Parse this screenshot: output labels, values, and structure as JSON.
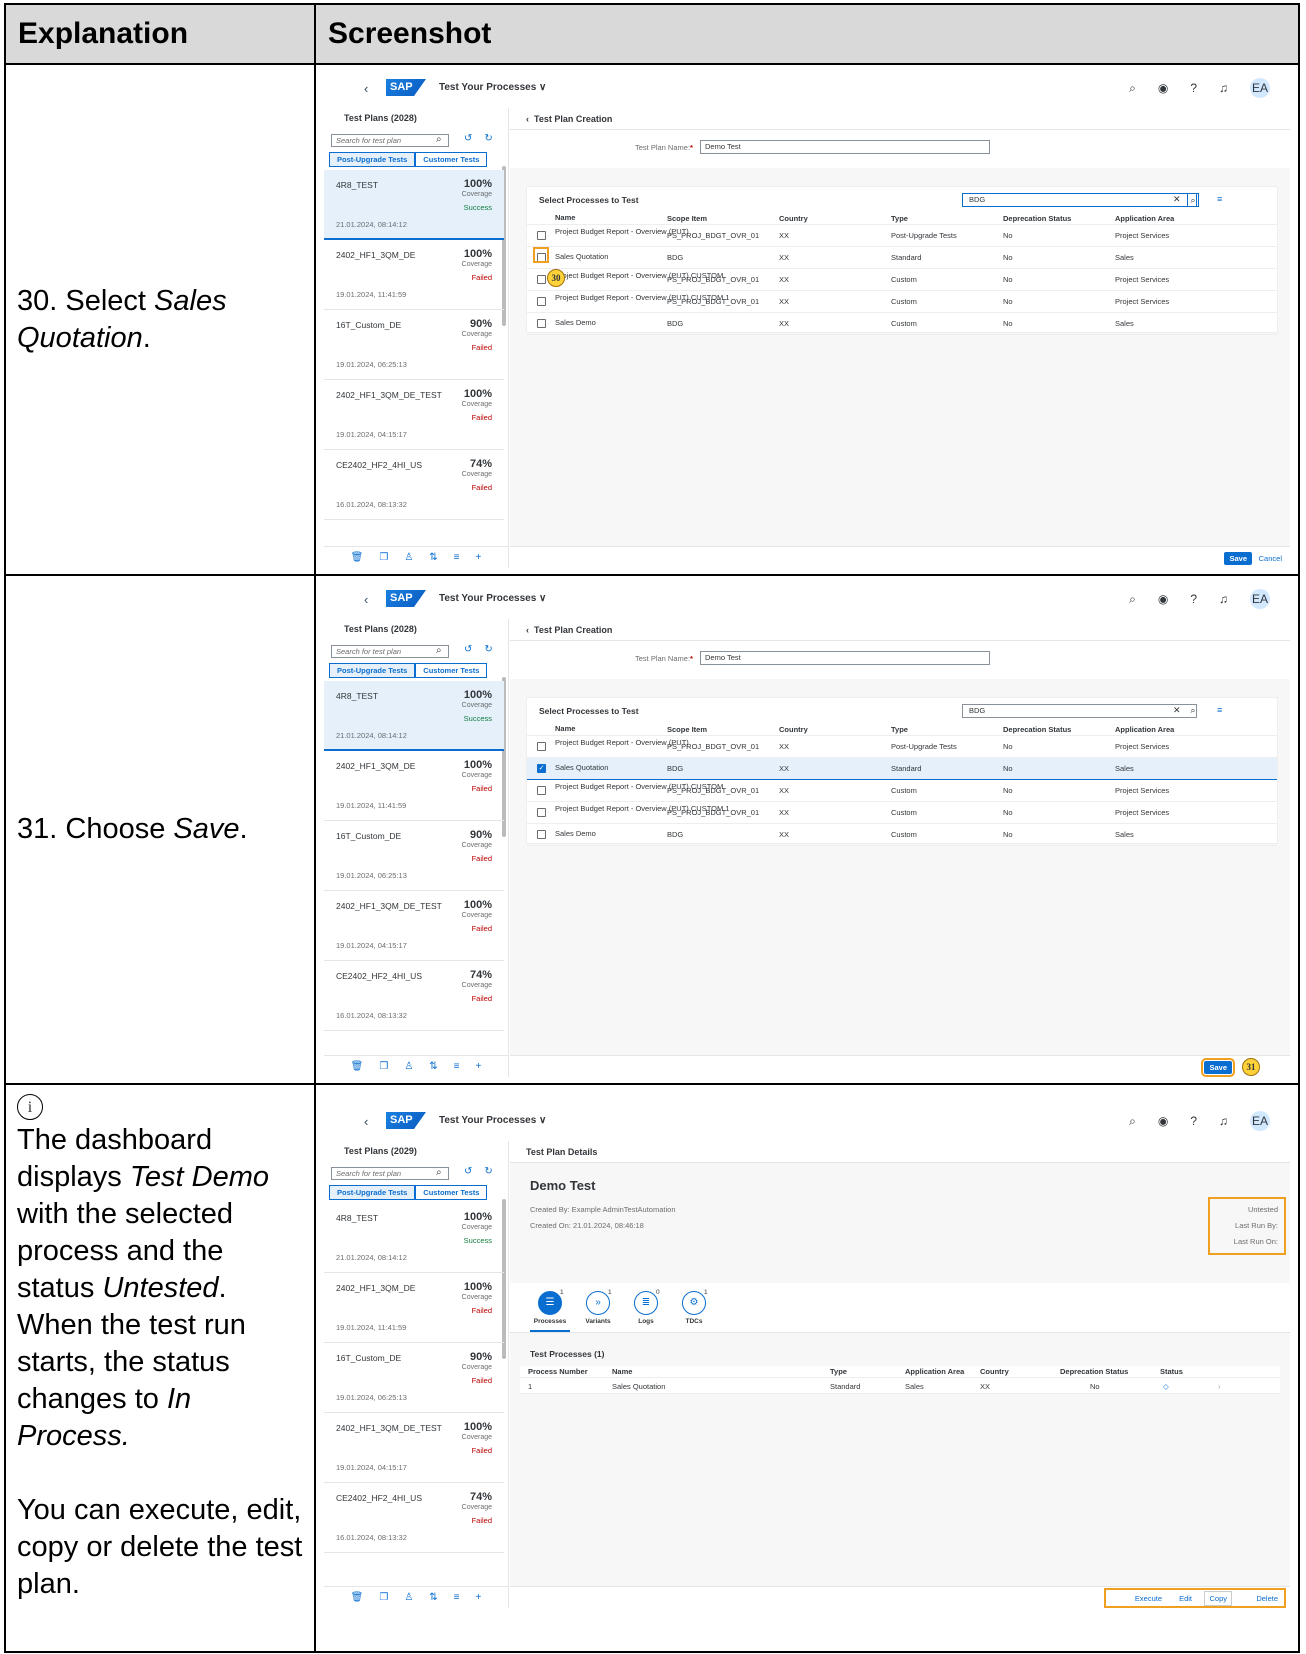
{
  "headers": {
    "explanation": "Explanation",
    "screenshot": "Screenshot"
  },
  "steps": [
    {
      "pre": "30. Select ",
      "em": "Sales Quotation",
      "post": "."
    },
    {
      "pre": "31. Choose ",
      "em": "Save",
      "post": "."
    }
  ],
  "note": {
    "icon": "info-icon",
    "p1_a": "The dashboard displays ",
    "p1_em1": "Test Demo",
    "p1_b": " with the selected process and the status ",
    "p1_em2": "Untested",
    "p1_c": ". When the test run starts, the status changes to ",
    "p1_em3": "In Process.",
    "p2": "You can execute, edit, copy or delete the test plan."
  },
  "app": {
    "title": "Test Your Processes ∨",
    "sap": "SAP",
    "avatar": "EA",
    "test_plans_title_a": "Test Plans (2028)",
    "test_plans_title_b": "Test Plans (2029)",
    "search_placeholder": "Search for test plan",
    "seg_post": "Post-Upgrade Tests",
    "seg_customer": "Customer Tests",
    "coverage": "Coverage",
    "plans": [
      {
        "name": "4R8_TEST",
        "pct": "100%",
        "status": "Success",
        "date": "21.01.2024, 08:14:12"
      },
      {
        "name": "2402_HF1_3QM_DE",
        "pct": "100%",
        "status": "Failed",
        "date": "19.01.2024, 11:41:59"
      },
      {
        "name": "16T_Custom_DE",
        "pct": "90%",
        "status": "Failed",
        "date": "19.01.2024, 06:25:13"
      },
      {
        "name": "2402_HF1_3QM_DE_TEST",
        "pct": "100%",
        "status": "Failed",
        "date": "19.01.2024, 04:15:17"
      },
      {
        "name": "CE2402_HF2_4HI_US",
        "pct": "74%",
        "status": "Failed",
        "date": "16.01.2024, 08:13:32"
      }
    ],
    "creation_title": "Test Plan Creation",
    "plan_name_label": "Test Plan Name:",
    "plan_name_value": "Demo Test",
    "select_title": "Select Processes to Test",
    "select_search": "BDG",
    "proc_cols": [
      "Name",
      "Scope Item",
      "Country",
      "Type",
      "Deprecation Status",
      "Application Area"
    ],
    "procs": [
      {
        "name": "Project Budget Report - Overview (PUT)",
        "scope": "PS_PROJ_BDGT_OVR_01",
        "country": "XX",
        "type": "Post-Upgrade Tests",
        "dep": "No",
        "area": "Project Services"
      },
      {
        "name": "Sales Quotation",
        "scope": "BDG",
        "country": "XX",
        "type": "Standard",
        "dep": "No",
        "area": "Sales"
      },
      {
        "name": "Project Budget Report - Overview (PUT) CUSTOM",
        "scope": "PS_PROJ_BDGT_OVR_01",
        "country": "XX",
        "type": "Custom",
        "dep": "No",
        "area": "Project Services"
      },
      {
        "name": "Project Budget Report - Overview (PUT) CUSTOM 1",
        "scope": "PS_PROJ_BDGT_OVR_01",
        "country": "XX",
        "type": "Custom",
        "dep": "No",
        "area": "Project Services"
      },
      {
        "name": "Sales Demo",
        "scope": "BDG",
        "country": "XX",
        "type": "Custom",
        "dep": "No",
        "area": "Sales"
      }
    ],
    "save": "Save",
    "cancel": "Cancel",
    "badge30": "30",
    "badge31": "31",
    "details_title": "Test Plan Details",
    "plan_title": "Demo Test",
    "created_by": "Created By: Example AdminTestAutomation",
    "created_on": "Created On: 21.01.2024, 08:46:18",
    "status_untested": "Untested",
    "last_run_by": "Last Run By:",
    "last_run_on": "Last Run On:",
    "tabs": [
      {
        "label": "Processes",
        "count": "1"
      },
      {
        "label": "Variants",
        "count": "1"
      },
      {
        "label": "Logs",
        "count": "0"
      },
      {
        "label": "TDCs",
        "count": "1"
      }
    ],
    "test_processes_title": "Test Processes (1)",
    "result_cols": [
      "Process Number",
      "Name",
      "Type",
      "Application Area",
      "Country",
      "Deprecation Status",
      "Status"
    ],
    "result_row": {
      "num": "1",
      "name": "Sales Quotation",
      "type": "Standard",
      "area": "Sales",
      "country": "XX",
      "dep": "No"
    },
    "execute": "Execute",
    "edit": "Edit",
    "copy": "Copy",
    "delete": "Delete"
  }
}
